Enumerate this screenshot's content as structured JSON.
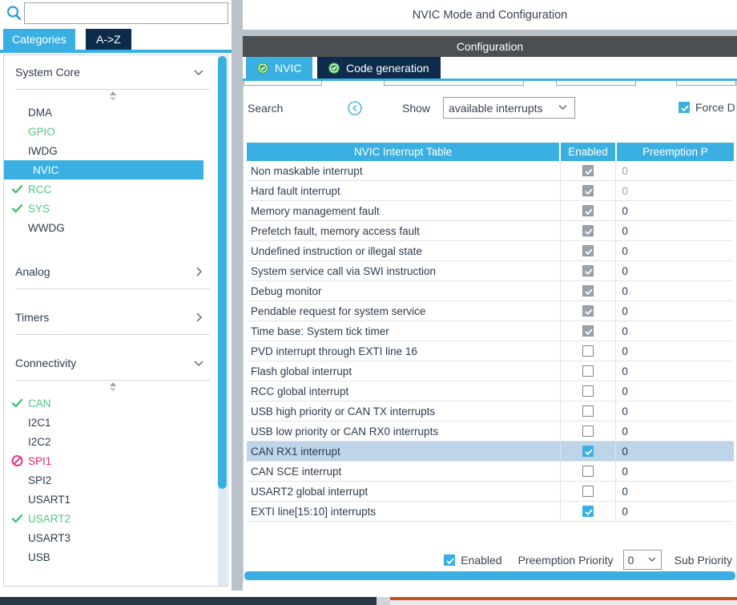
{
  "left_panel": {
    "search": {
      "value": "",
      "placeholder": ""
    },
    "tabs": [
      {
        "label": "Categories",
        "active": true
      },
      {
        "label": "A->Z",
        "active": false
      }
    ],
    "sections": [
      {
        "title": "System Core",
        "expanded": true
      },
      {
        "title": "Analog",
        "expanded": false
      },
      {
        "title": "Timers",
        "expanded": false
      },
      {
        "title": "Connectivity",
        "expanded": true
      }
    ],
    "system_core_items": [
      {
        "label": "DMA",
        "state": "none",
        "selected": false
      },
      {
        "label": "GPIO",
        "state": "green",
        "selected": false
      },
      {
        "label": "IWDG",
        "state": "none",
        "selected": false
      },
      {
        "label": "NVIC",
        "state": "none",
        "selected": true
      },
      {
        "label": "RCC",
        "state": "check",
        "selected": false
      },
      {
        "label": "SYS",
        "state": "check",
        "selected": false
      },
      {
        "label": "WWDG",
        "state": "none",
        "selected": false
      }
    ],
    "connectivity_items": [
      {
        "label": "CAN",
        "state": "check",
        "selected": false
      },
      {
        "label": "I2C1",
        "state": "none",
        "selected": false
      },
      {
        "label": "I2C2",
        "state": "none",
        "selected": false
      },
      {
        "label": "SPI1",
        "state": "forbidden",
        "selected": false
      },
      {
        "label": "SPI2",
        "state": "none",
        "selected": false
      },
      {
        "label": "USART1",
        "state": "none",
        "selected": false
      },
      {
        "label": "USART2",
        "state": "check",
        "selected": false
      },
      {
        "label": "USART3",
        "state": "none",
        "selected": false
      },
      {
        "label": "USB",
        "state": "none",
        "selected": false
      }
    ]
  },
  "right_panel": {
    "title": "NVIC Mode and Configuration",
    "configuration_label": "Configuration",
    "tabs": [
      {
        "label": "NVIC",
        "active": true
      },
      {
        "label": "Code generation",
        "active": false
      }
    ],
    "filters": {
      "search_label": "Search",
      "reset_icon": "reset-search-icon",
      "show_label": "Show",
      "show_value": "available interrupts",
      "force_dma_label": "Force D",
      "force_dma_checked": true
    },
    "table": {
      "headers": [
        "NVIC Interrupt Table",
        "Enabled",
        "Preemption P"
      ],
      "rows": [
        {
          "name": "Non maskable interrupt",
          "enabled": true,
          "enabled_locked": true,
          "priority": "0",
          "priority_dim": true,
          "selected": false
        },
        {
          "name": "Hard fault interrupt",
          "enabled": true,
          "enabled_locked": true,
          "priority": "0",
          "priority_dim": true,
          "selected": false
        },
        {
          "name": "Memory management fault",
          "enabled": true,
          "enabled_locked": true,
          "priority": "0",
          "priority_dim": false,
          "selected": false
        },
        {
          "name": "Prefetch fault, memory access fault",
          "enabled": true,
          "enabled_locked": true,
          "priority": "0",
          "priority_dim": false,
          "selected": false
        },
        {
          "name": "Undefined instruction or illegal state",
          "enabled": true,
          "enabled_locked": true,
          "priority": "0",
          "priority_dim": false,
          "selected": false
        },
        {
          "name": "System service call via SWI instruction",
          "enabled": true,
          "enabled_locked": true,
          "priority": "0",
          "priority_dim": false,
          "selected": false
        },
        {
          "name": "Debug monitor",
          "enabled": true,
          "enabled_locked": true,
          "priority": "0",
          "priority_dim": false,
          "selected": false
        },
        {
          "name": "Pendable request for system service",
          "enabled": true,
          "enabled_locked": true,
          "priority": "0",
          "priority_dim": false,
          "selected": false
        },
        {
          "name": "Time base: System tick timer",
          "enabled": true,
          "enabled_locked": true,
          "priority": "0",
          "priority_dim": false,
          "selected": false
        },
        {
          "name": "PVD interrupt through EXTI line 16",
          "enabled": false,
          "enabled_locked": false,
          "priority": "0",
          "priority_dim": false,
          "selected": false
        },
        {
          "name": "Flash global interrupt",
          "enabled": false,
          "enabled_locked": false,
          "priority": "0",
          "priority_dim": false,
          "selected": false
        },
        {
          "name": "RCC global interrupt",
          "enabled": false,
          "enabled_locked": false,
          "priority": "0",
          "priority_dim": false,
          "selected": false
        },
        {
          "name": "USB high priority or CAN TX interrupts",
          "enabled": false,
          "enabled_locked": false,
          "priority": "0",
          "priority_dim": false,
          "selected": false
        },
        {
          "name": "USB low priority or CAN RX0 interrupts",
          "enabled": false,
          "enabled_locked": false,
          "priority": "0",
          "priority_dim": false,
          "selected": false
        },
        {
          "name": "CAN RX1 interrupt",
          "enabled": true,
          "enabled_locked": false,
          "priority": "0",
          "priority_dim": false,
          "selected": true
        },
        {
          "name": "CAN SCE interrupt",
          "enabled": false,
          "enabled_locked": false,
          "priority": "0",
          "priority_dim": false,
          "selected": false
        },
        {
          "name": "USART2 global interrupt",
          "enabled": false,
          "enabled_locked": false,
          "priority": "0",
          "priority_dim": false,
          "selected": false
        },
        {
          "name": "EXTI line[15:10] interrupts",
          "enabled": true,
          "enabled_locked": false,
          "priority": "0",
          "priority_dim": false,
          "selected": false
        }
      ]
    },
    "bottom_controls": {
      "enabled_label": "Enabled",
      "enabled_checked": true,
      "preemption_label": "Preemption Priority",
      "preemption_value": "0",
      "sub_priority_label": "Sub Priority"
    }
  },
  "colors": {
    "accent_blue": "#3ab0e2",
    "dark_navy": "#0d2c4b",
    "config_grey": "#4b4f52",
    "green": "#4fc97f",
    "pink": "#e8227a",
    "row_selected": "#bed4e8"
  }
}
